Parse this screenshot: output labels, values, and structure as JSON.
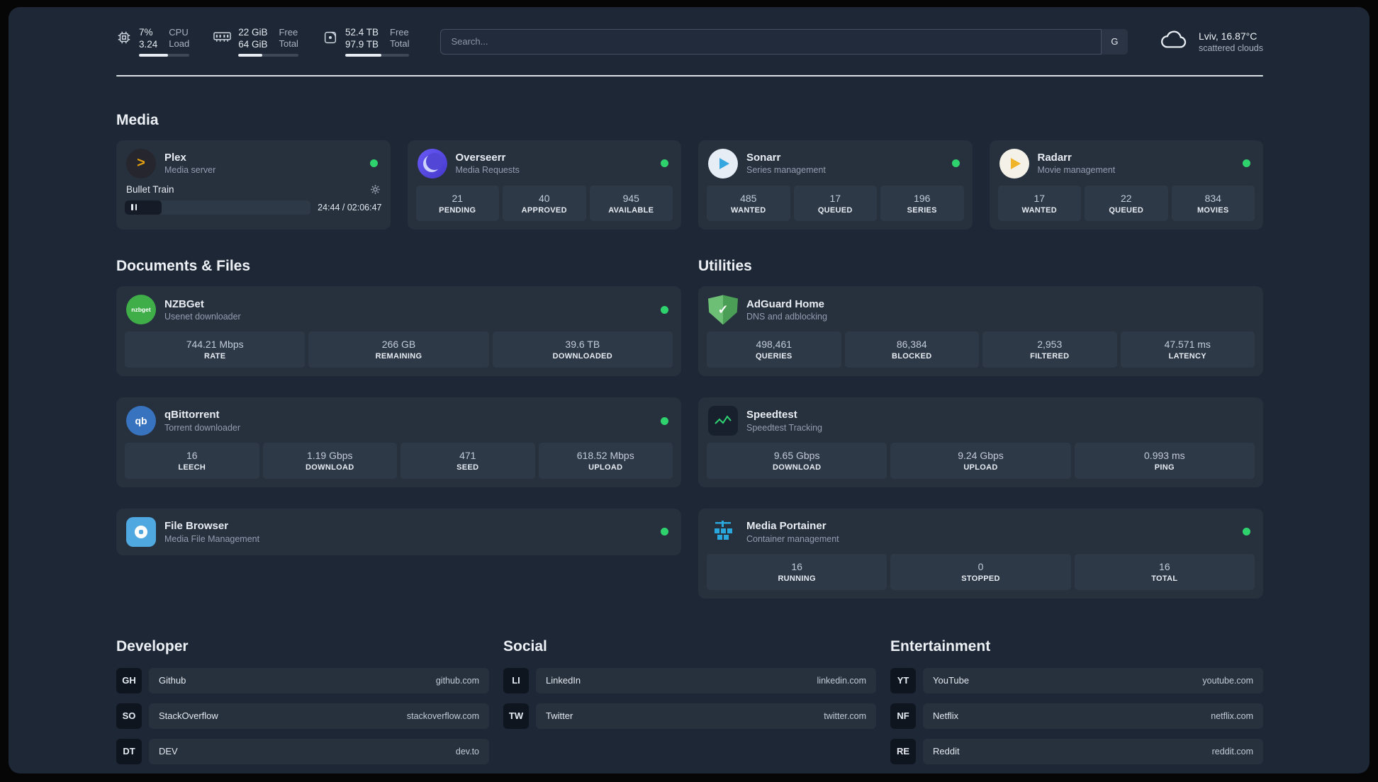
{
  "colors": {
    "status_online": "#2fd36e",
    "panel_bg": "#1d2735",
    "card_bg": "#27313e",
    "tile_bg": "#2e3947"
  },
  "topbar": {
    "cpu": {
      "value": "7%",
      "sub": "3.24",
      "label_top": "CPU",
      "label_bottom": "Load"
    },
    "memory": {
      "value": "22 GiB",
      "sub": "64 GiB",
      "label_top": "Free",
      "label_bottom": "Total"
    },
    "disk": {
      "value": "52.4 TB",
      "sub": "97.9 TB",
      "label_top": "Free",
      "label_bottom": "Total"
    },
    "search": {
      "placeholder": "Search...",
      "button_label": "G"
    },
    "weather": {
      "location": "Lviv, 16.87°C",
      "condition": "scattered clouds"
    }
  },
  "media": {
    "title": "Media",
    "plex": {
      "name": "Plex",
      "subtitle": "Media server",
      "now_playing": "Bullet Train",
      "time": "24:44 / 02:06:47"
    },
    "overseerr": {
      "name": "Overseerr",
      "subtitle": "Media Requests",
      "stats": [
        {
          "value": "21",
          "label": "PENDING"
        },
        {
          "value": "40",
          "label": "APPROVED"
        },
        {
          "value": "945",
          "label": "AVAILABLE"
        }
      ]
    },
    "sonarr": {
      "name": "Sonarr",
      "subtitle": "Series management",
      "stats": [
        {
          "value": "485",
          "label": "WANTED"
        },
        {
          "value": "17",
          "label": "QUEUED"
        },
        {
          "value": "196",
          "label": "SERIES"
        }
      ]
    },
    "radarr": {
      "name": "Radarr",
      "subtitle": "Movie management",
      "stats": [
        {
          "value": "17",
          "label": "WANTED"
        },
        {
          "value": "22",
          "label": "QUEUED"
        },
        {
          "value": "834",
          "label": "MOVIES"
        }
      ]
    }
  },
  "documents": {
    "title": "Documents & Files",
    "nzbget": {
      "name": "NZBGet",
      "subtitle": "Usenet downloader",
      "icon_text": "nzbget",
      "stats": [
        {
          "value": "744.21 Mbps",
          "label": "RATE"
        },
        {
          "value": "266 GB",
          "label": "REMAINING"
        },
        {
          "value": "39.6 TB",
          "label": "DOWNLOADED"
        }
      ]
    },
    "qbittorrent": {
      "name": "qBittorrent",
      "subtitle": "Torrent downloader",
      "icon_text": "qb",
      "stats": [
        {
          "value": "16",
          "label": "LEECH"
        },
        {
          "value": "1.19 Gbps",
          "label": "DOWNLOAD"
        },
        {
          "value": "471",
          "label": "SEED"
        },
        {
          "value": "618.52 Mbps",
          "label": "UPLOAD"
        }
      ]
    },
    "filebrowser": {
      "name": "File Browser",
      "subtitle": "Media File Management"
    }
  },
  "utilities": {
    "title": "Utilities",
    "adguard": {
      "name": "AdGuard Home",
      "subtitle": "DNS and adblocking",
      "stats": [
        {
          "value": "498,461",
          "label": "QUERIES"
        },
        {
          "value": "86,384",
          "label": "BLOCKED"
        },
        {
          "value": "2,953",
          "label": "FILTERED"
        },
        {
          "value": "47.571 ms",
          "label": "LATENCY"
        }
      ]
    },
    "speedtest": {
      "name": "Speedtest",
      "subtitle": "Speedtest Tracking",
      "stats": [
        {
          "value": "9.65 Gbps",
          "label": "DOWNLOAD"
        },
        {
          "value": "9.24 Gbps",
          "label": "UPLOAD"
        },
        {
          "value": "0.993 ms",
          "label": "PING"
        }
      ]
    },
    "portainer": {
      "name": "Media Portainer",
      "subtitle": "Container management",
      "stats": [
        {
          "value": "16",
          "label": "RUNNING"
        },
        {
          "value": "0",
          "label": "STOPPED"
        },
        {
          "value": "16",
          "label": "TOTAL"
        }
      ]
    }
  },
  "links": {
    "developer": {
      "title": "Developer",
      "items": [
        {
          "abbr": "GH",
          "name": "Github",
          "domain": "github.com"
        },
        {
          "abbr": "SO",
          "name": "StackOverflow",
          "domain": "stackoverflow.com"
        },
        {
          "abbr": "DT",
          "name": "DEV",
          "domain": "dev.to"
        }
      ]
    },
    "social": {
      "title": "Social",
      "items": [
        {
          "abbr": "LI",
          "name": "LinkedIn",
          "domain": "linkedin.com"
        },
        {
          "abbr": "TW",
          "name": "Twitter",
          "domain": "twitter.com"
        }
      ]
    },
    "entertainment": {
      "title": "Entertainment",
      "items": [
        {
          "abbr": "YT",
          "name": "YouTube",
          "domain": "youtube.com"
        },
        {
          "abbr": "NF",
          "name": "Netflix",
          "domain": "netflix.com"
        },
        {
          "abbr": "RE",
          "name": "Reddit",
          "domain": "reddit.com"
        }
      ]
    }
  }
}
